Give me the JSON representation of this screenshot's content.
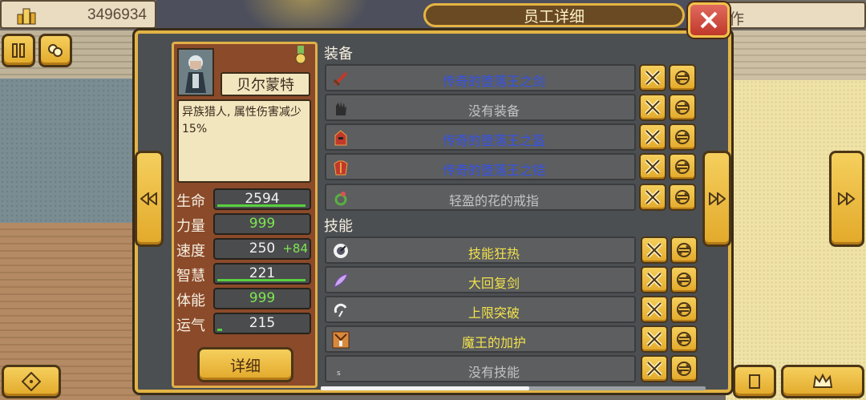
{
  "top": {
    "money": "3496934",
    "title": "员工详细",
    "right_text": "作"
  },
  "employee": {
    "name": "贝尔蒙特",
    "description": "异族猎人, 属性伤害减少15%",
    "stats": [
      {
        "label": "生命",
        "value": "2594",
        "bonus": "",
        "fill": 0.98,
        "green": false
      },
      {
        "label": "力量",
        "value": "999",
        "bonus": "",
        "fill": 0.0,
        "green": true
      },
      {
        "label": "速度",
        "value": "250",
        "bonus": "+84",
        "fill": 0.0,
        "green": false
      },
      {
        "label": "智慧",
        "value": "221",
        "bonus": "",
        "fill": 0.98,
        "green": false
      },
      {
        "label": "体能",
        "value": "999",
        "bonus": "",
        "fill": 0.0,
        "green": true
      },
      {
        "label": "运气",
        "value": "215",
        "bonus": "",
        "fill": 0.05,
        "green": false
      }
    ],
    "detail_button": "详细"
  },
  "equipment": {
    "header": "装备",
    "items": [
      {
        "label": "传奇的堕落王之剑",
        "color": "blue",
        "icon": "sword-icon"
      },
      {
        "label": "没有装备",
        "color": "gray",
        "icon": "glove-icon"
      },
      {
        "label": "传奇的堕落王之盔",
        "color": "blue",
        "icon": "helmet-icon"
      },
      {
        "label": "传奇的堕落王之铠",
        "color": "blue",
        "icon": "armor-icon"
      },
      {
        "label": "轻盈的花的戒指",
        "color": "gray",
        "icon": "ring-icon"
      }
    ]
  },
  "skills": {
    "header": "技能",
    "items": [
      {
        "label": "技能狂热",
        "color": "yellow",
        "icon": "fervor-icon"
      },
      {
        "label": "大回复剑",
        "color": "yellow",
        "icon": "feather-icon"
      },
      {
        "label": "上限突破",
        "color": "yellow",
        "icon": "break-icon"
      },
      {
        "label": "魔王的加护",
        "color": "yellow",
        "icon": "demon-king-icon"
      },
      {
        "label": "没有技能",
        "color": "gray",
        "icon": "empty-icon"
      }
    ]
  },
  "colors": {
    "gold": "#e2a92a",
    "panel": "#4c4f52",
    "blue_text": "#3652e6",
    "yellow_text": "#f2e14c",
    "green_text": "#7ee651"
  }
}
